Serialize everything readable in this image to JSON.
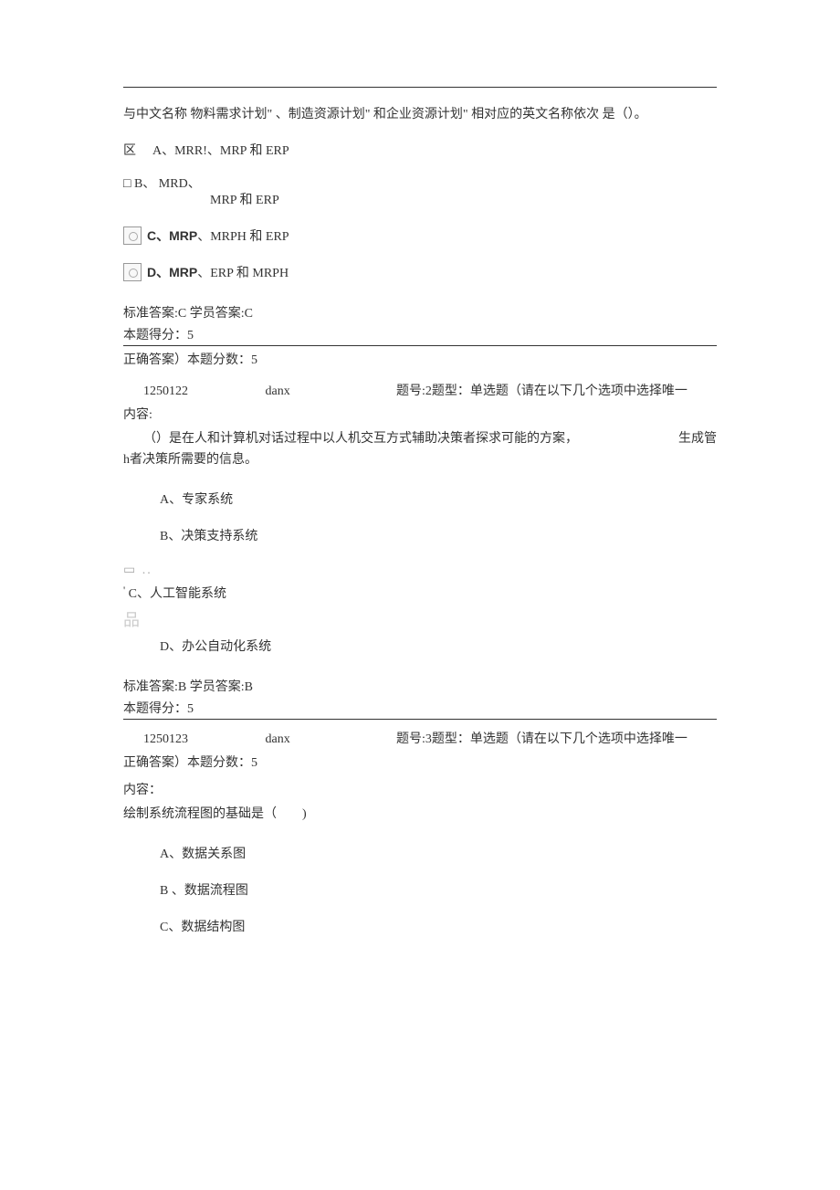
{
  "q1": {
    "stem": "与中文名称 物料需求计划\" 、制造资源计划\" 和企业资源计划\" 相对应的英文名称依次 是（）。",
    "optA_marker": "区",
    "optA": "A、MRR!、MRP 和 ERP",
    "optB_marker": "□",
    "optB_line1": "B、 MRD、",
    "optB_line2": "MRP 和 ERP",
    "optC_label": "C、MRP",
    "optC_rest": "、MRPH 和 ERP",
    "optD_label": "D、MRP",
    "optD_rest": "、ERP 和 MRPH",
    "answer": "标准答案:C 学员答案:C",
    "score": "本题得分：5",
    "correct_score": "正确答案）本题分数：5"
  },
  "q2": {
    "code": "1250122",
    "type": "danx",
    "header": "题号:2题型：单选题（请在以下几个选项中选择唯一",
    "content_label": "内容:",
    "stem1": "（）是在人和计算机对话过程中以人机交互方式辅助决策者探求可能的方案，",
    "stem_right": "生成管",
    "stem2": "h者决策所需要的信息。",
    "optA": "A、专家系统",
    "optB": "B、决策支持系统",
    "optC_prefix": "'",
    "optC": "C、人工智能系统",
    "box_glyph": "品",
    "optD": "D、办公自动化系统",
    "answer": "标准答案:B 学员答案:B",
    "score": "本题得分：5"
  },
  "q3": {
    "code": "1250123",
    "type": "danx",
    "header": "题号:3题型：单选题（请在以下几个选项中选择唯一",
    "correct_score": "正确答案）本题分数：5",
    "content_label": "内容：",
    "stem": "绘制系统流程图的基础是（　　)",
    "optA": "A、数据关系图",
    "optB": "B 、数据流程图",
    "optC": "C、数据结构图"
  }
}
